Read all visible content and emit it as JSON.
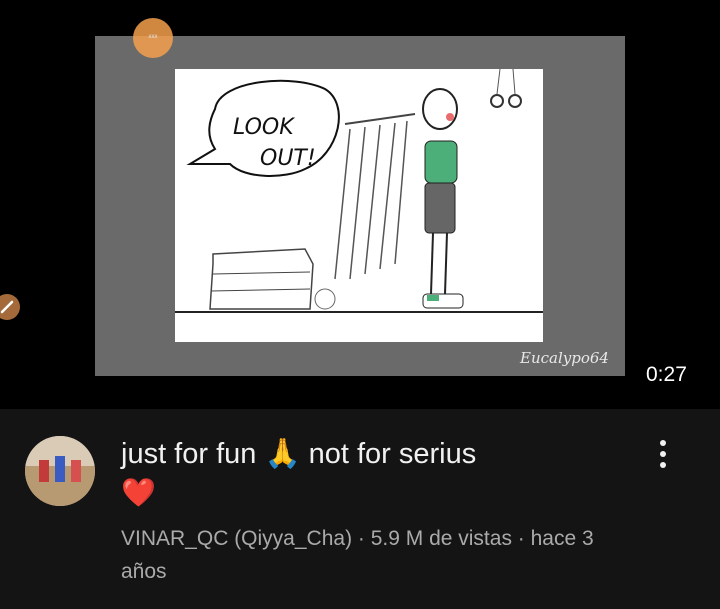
{
  "video": {
    "cursor_label": "xxx",
    "watermark": "Eucalypo64",
    "duration": "0:27",
    "comic_text": "LOOK OUT!"
  },
  "details": {
    "title": "just for fun 🙏 not for serius",
    "emoji": "❤️",
    "meta": "VINAR_QC (Qiyya_Cha) · 5.9 M de vistas · hace 3 años"
  },
  "icons": {
    "pen": "pen-icon",
    "menu": "more-vert-icon",
    "heart": "heart-icon"
  }
}
